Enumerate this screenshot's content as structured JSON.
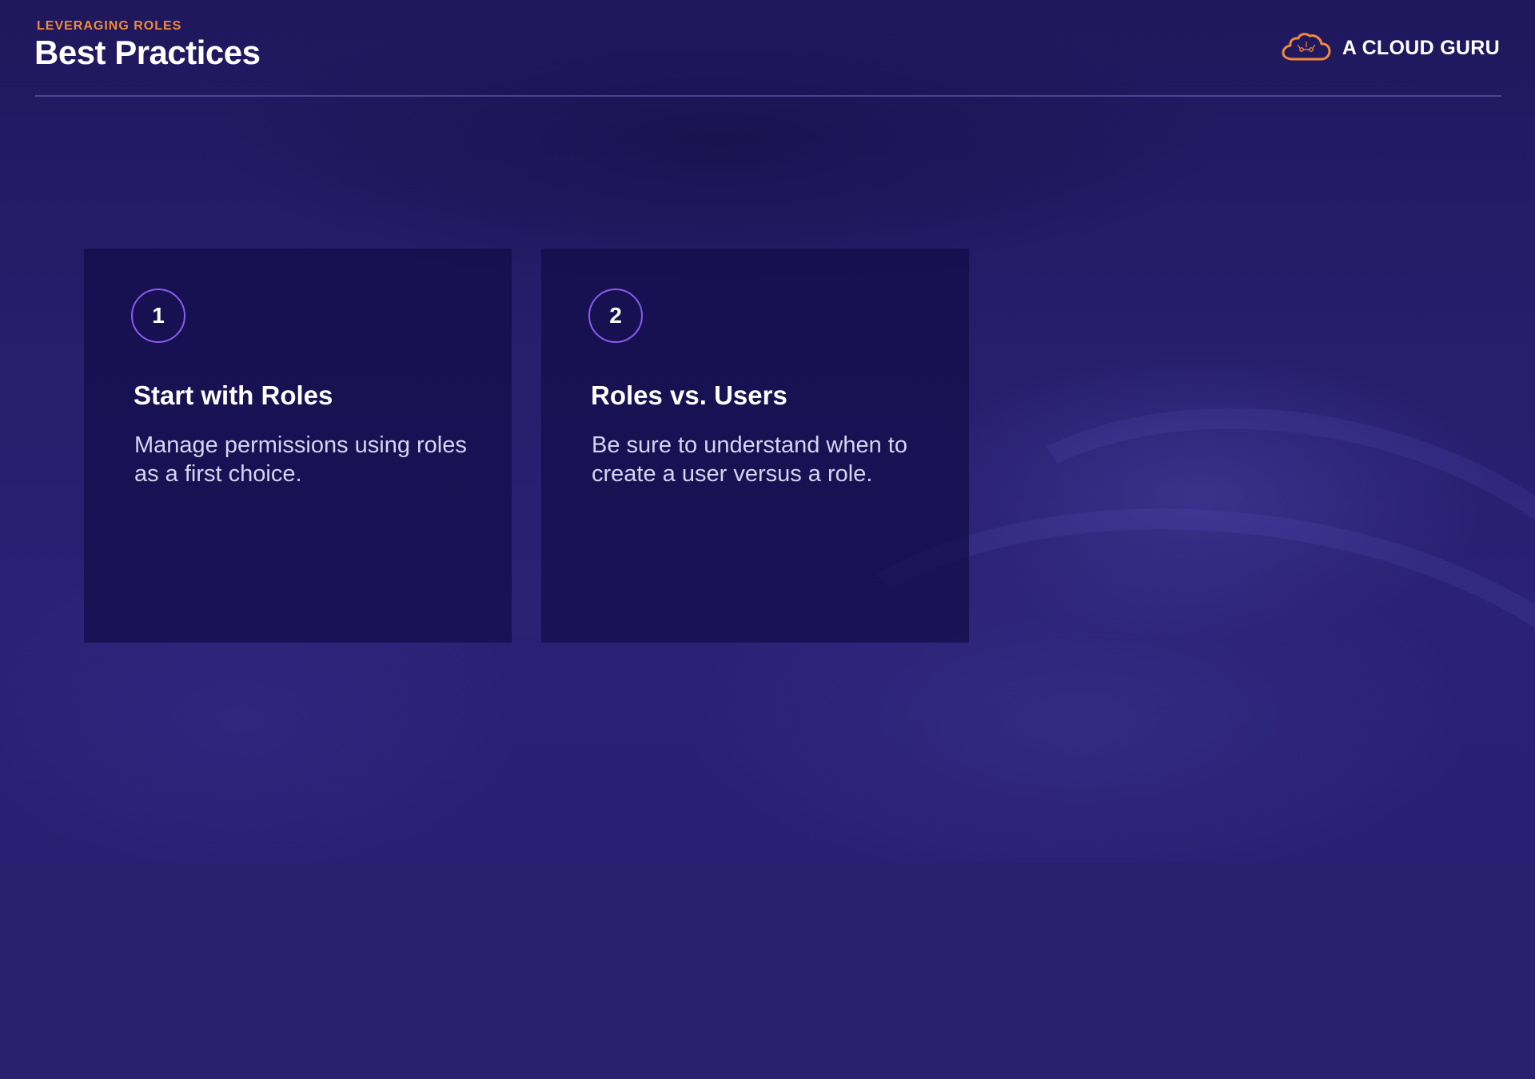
{
  "header": {
    "kicker": "LEVERAGING ROLES",
    "title": "Best Practices"
  },
  "brand": {
    "name": "A CLOUD GURU",
    "icon": "cloud-icon",
    "icon_color": "#f08a3c"
  },
  "colors": {
    "accent_orange": "#f08a3c",
    "badge_ring": "#8a5cf0",
    "background": "#2a2070"
  },
  "cards": [
    {
      "number": "1",
      "title": "Start with Roles",
      "body": "Manage permissions using roles as a first choice."
    },
    {
      "number": "2",
      "title": "Roles vs. Users",
      "body": "Be sure to understand when to create a user versus a role."
    }
  ]
}
